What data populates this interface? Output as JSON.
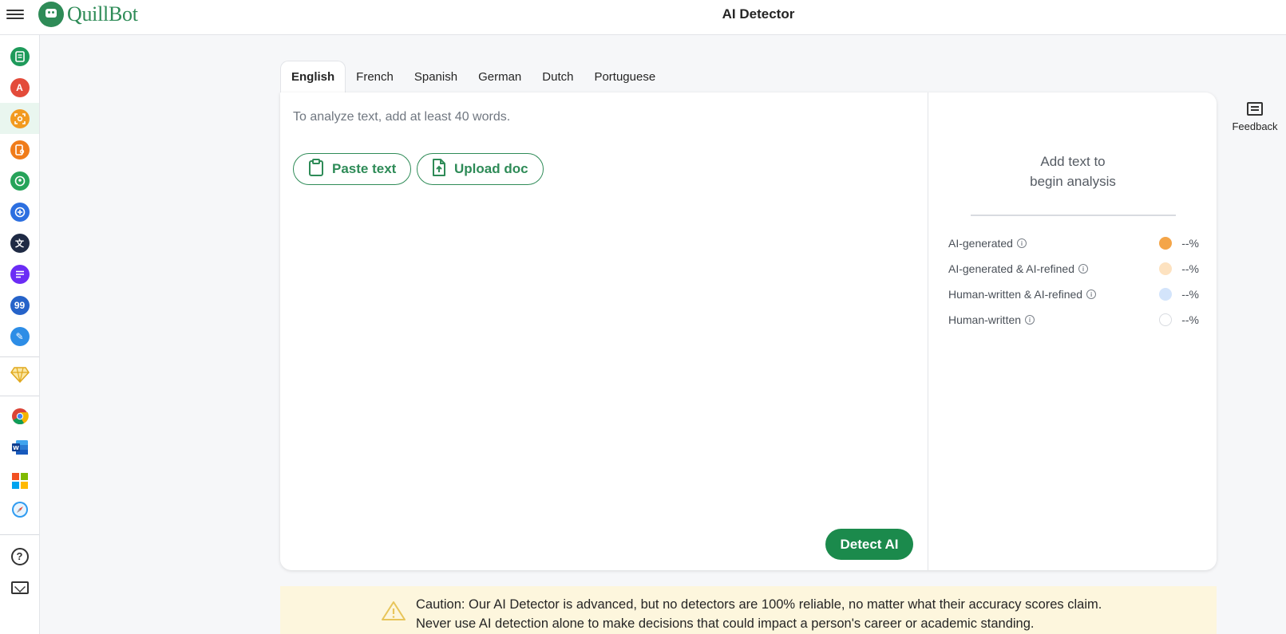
{
  "header": {
    "brand": "QuillBot",
    "title": "AI Detector"
  },
  "rail": {
    "tools": [
      {
        "icon": "paraphraser-icon",
        "color": "#1e9a5a",
        "glyph": "≡"
      },
      {
        "icon": "grammar-checker-icon",
        "color": "#e34b3a",
        "glyph": "A"
      },
      {
        "icon": "ai-detector-icon",
        "color": "#f29a1f",
        "glyph": "⌖",
        "active": true
      },
      {
        "icon": "plagiarism-checker-icon",
        "color": "#f07c1a",
        "glyph": "⎘"
      },
      {
        "icon": "ai-humanizer-icon",
        "color": "#27a35a",
        "glyph": "☺"
      },
      {
        "icon": "ai-chat-icon",
        "color": "#2c6fe0",
        "glyph": "+"
      },
      {
        "icon": "translator-icon",
        "color": "#1f2a44",
        "glyph": "文"
      },
      {
        "icon": "summarizer-icon",
        "color": "#6b2cf5",
        "glyph": "≡"
      },
      {
        "icon": "citation-generator-icon",
        "color": "#2663c9",
        "glyph": "99"
      },
      {
        "icon": "quillbot-flow-icon",
        "color": "#2d8de6",
        "glyph": "✎"
      }
    ],
    "premium": {
      "icon": "premium-diamond-icon"
    },
    "extensions": [
      {
        "icon": "chrome-extension-icon"
      },
      {
        "icon": "word-addin-icon"
      },
      {
        "icon": "microsoft-store-icon"
      },
      {
        "icon": "safari-extension-icon"
      }
    ],
    "help": {
      "icon": "help-icon",
      "glyph": "?"
    },
    "contact": {
      "icon": "mail-icon"
    }
  },
  "tabs": [
    {
      "label": "English",
      "active": true
    },
    {
      "label": "French"
    },
    {
      "label": "Spanish"
    },
    {
      "label": "German"
    },
    {
      "label": "Dutch"
    },
    {
      "label": "Portuguese"
    }
  ],
  "editor": {
    "placeholder": "To analyze text, add at least 40 words.",
    "paste_label": "Paste text",
    "upload_label": "Upload doc",
    "detect_label": "Detect AI"
  },
  "results": {
    "empty_line1": "Add text to",
    "empty_line2": "begin analysis",
    "legend": [
      {
        "label": "AI-generated",
        "value": "--%",
        "color": "#f4a548"
      },
      {
        "label": "AI-generated & AI-refined",
        "value": "--%",
        "color": "#fde2c0"
      },
      {
        "label": "Human-written & AI-refined",
        "value": "--%",
        "color": "#d3e4fb"
      },
      {
        "label": "Human-written",
        "value": "--%",
        "color": "#ffffff"
      }
    ]
  },
  "feedback": {
    "label": "Feedback"
  },
  "caution": {
    "line1": "Caution: Our AI Detector is advanced, but no detectors are 100% reliable, no matter what their accuracy scores claim.",
    "line2": "Never use AI detection alone to make decisions that could impact a person's career or academic standing."
  },
  "colors": {
    "brand": "#2e8b57",
    "detect_button": "#1b8a4c",
    "caution_bg": "#fdf6dd"
  }
}
